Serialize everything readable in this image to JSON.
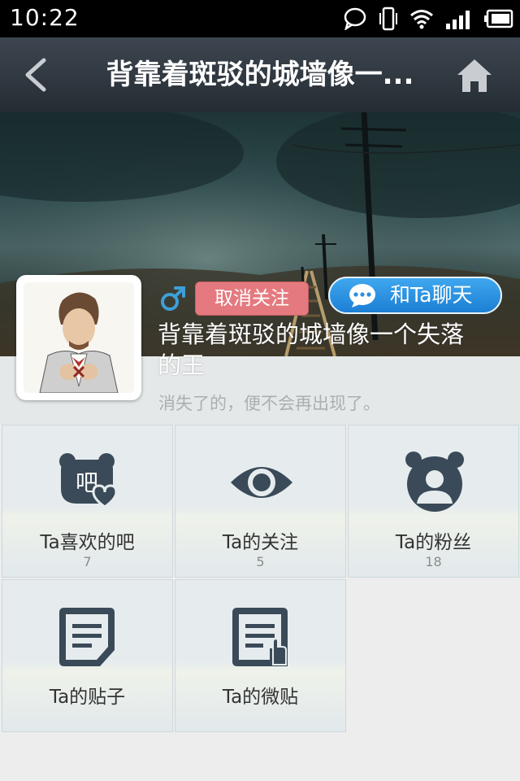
{
  "status_bar": {
    "time": "10:22",
    "icons": [
      "chat-bubble-icon",
      "vibrate-icon",
      "wifi-icon",
      "signal-icon",
      "battery-icon"
    ]
  },
  "nav": {
    "title": "背靠着斑驳的城墙像一...",
    "back_icon": "back-arrow-icon",
    "home_icon": "home-icon"
  },
  "profile": {
    "gender_symbol": "♂",
    "unfollow_label": "取消关注",
    "chat_label": "和Ta聊天",
    "username_line1": "背靠着斑驳的城墙像一个失落",
    "username_line2": "的王",
    "signature": "消失了的，便不会再出现了。"
  },
  "grid": [
    {
      "label": "Ta喜欢的吧",
      "count": "7",
      "icon": "liked-bars-icon"
    },
    {
      "label": "Ta的关注",
      "count": "5",
      "icon": "eye-icon"
    },
    {
      "label": "Ta的粉丝",
      "count": "18",
      "icon": "fans-icon"
    },
    {
      "label": "Ta的贴子",
      "count": "",
      "icon": "posts-icon"
    },
    {
      "label": "Ta的微贴",
      "count": "",
      "icon": "micro-posts-icon"
    }
  ],
  "colors": {
    "nav_bg": "#2c333a",
    "unfollow": "#e47a7f",
    "chat": "#2b8ee0",
    "icon": "#3a4a58"
  }
}
